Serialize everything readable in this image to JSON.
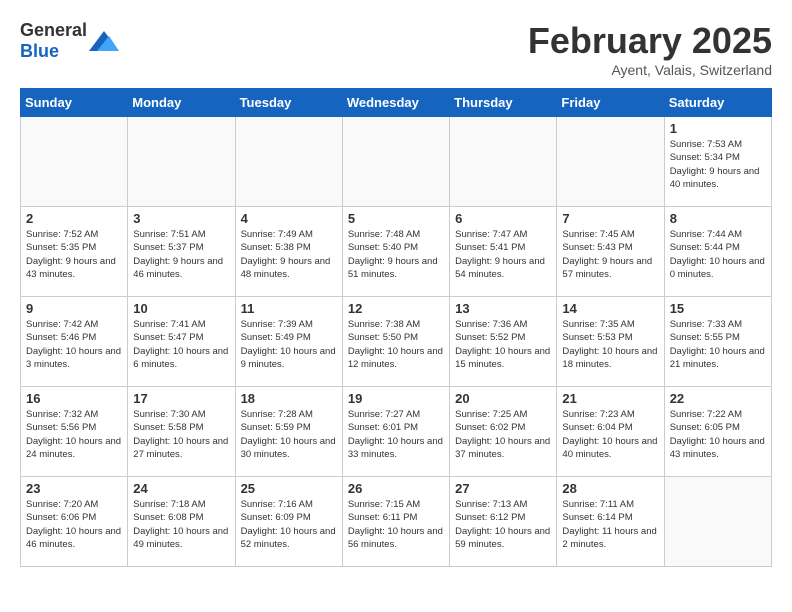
{
  "header": {
    "logo_general": "General",
    "logo_blue": "Blue",
    "month_year": "February 2025",
    "location": "Ayent, Valais, Switzerland"
  },
  "calendar": {
    "days_of_week": [
      "Sunday",
      "Monday",
      "Tuesday",
      "Wednesday",
      "Thursday",
      "Friday",
      "Saturday"
    ],
    "weeks": [
      [
        {
          "day": "",
          "info": ""
        },
        {
          "day": "",
          "info": ""
        },
        {
          "day": "",
          "info": ""
        },
        {
          "day": "",
          "info": ""
        },
        {
          "day": "",
          "info": ""
        },
        {
          "day": "",
          "info": ""
        },
        {
          "day": "1",
          "info": "Sunrise: 7:53 AM\nSunset: 5:34 PM\nDaylight: 9 hours and 40 minutes."
        }
      ],
      [
        {
          "day": "2",
          "info": "Sunrise: 7:52 AM\nSunset: 5:35 PM\nDaylight: 9 hours and 43 minutes."
        },
        {
          "day": "3",
          "info": "Sunrise: 7:51 AM\nSunset: 5:37 PM\nDaylight: 9 hours and 46 minutes."
        },
        {
          "day": "4",
          "info": "Sunrise: 7:49 AM\nSunset: 5:38 PM\nDaylight: 9 hours and 48 minutes."
        },
        {
          "day": "5",
          "info": "Sunrise: 7:48 AM\nSunset: 5:40 PM\nDaylight: 9 hours and 51 minutes."
        },
        {
          "day": "6",
          "info": "Sunrise: 7:47 AM\nSunset: 5:41 PM\nDaylight: 9 hours and 54 minutes."
        },
        {
          "day": "7",
          "info": "Sunrise: 7:45 AM\nSunset: 5:43 PM\nDaylight: 9 hours and 57 minutes."
        },
        {
          "day": "8",
          "info": "Sunrise: 7:44 AM\nSunset: 5:44 PM\nDaylight: 10 hours and 0 minutes."
        }
      ],
      [
        {
          "day": "9",
          "info": "Sunrise: 7:42 AM\nSunset: 5:46 PM\nDaylight: 10 hours and 3 minutes."
        },
        {
          "day": "10",
          "info": "Sunrise: 7:41 AM\nSunset: 5:47 PM\nDaylight: 10 hours and 6 minutes."
        },
        {
          "day": "11",
          "info": "Sunrise: 7:39 AM\nSunset: 5:49 PM\nDaylight: 10 hours and 9 minutes."
        },
        {
          "day": "12",
          "info": "Sunrise: 7:38 AM\nSunset: 5:50 PM\nDaylight: 10 hours and 12 minutes."
        },
        {
          "day": "13",
          "info": "Sunrise: 7:36 AM\nSunset: 5:52 PM\nDaylight: 10 hours and 15 minutes."
        },
        {
          "day": "14",
          "info": "Sunrise: 7:35 AM\nSunset: 5:53 PM\nDaylight: 10 hours and 18 minutes."
        },
        {
          "day": "15",
          "info": "Sunrise: 7:33 AM\nSunset: 5:55 PM\nDaylight: 10 hours and 21 minutes."
        }
      ],
      [
        {
          "day": "16",
          "info": "Sunrise: 7:32 AM\nSunset: 5:56 PM\nDaylight: 10 hours and 24 minutes."
        },
        {
          "day": "17",
          "info": "Sunrise: 7:30 AM\nSunset: 5:58 PM\nDaylight: 10 hours and 27 minutes."
        },
        {
          "day": "18",
          "info": "Sunrise: 7:28 AM\nSunset: 5:59 PM\nDaylight: 10 hours and 30 minutes."
        },
        {
          "day": "19",
          "info": "Sunrise: 7:27 AM\nSunset: 6:01 PM\nDaylight: 10 hours and 33 minutes."
        },
        {
          "day": "20",
          "info": "Sunrise: 7:25 AM\nSunset: 6:02 PM\nDaylight: 10 hours and 37 minutes."
        },
        {
          "day": "21",
          "info": "Sunrise: 7:23 AM\nSunset: 6:04 PM\nDaylight: 10 hours and 40 minutes."
        },
        {
          "day": "22",
          "info": "Sunrise: 7:22 AM\nSunset: 6:05 PM\nDaylight: 10 hours and 43 minutes."
        }
      ],
      [
        {
          "day": "23",
          "info": "Sunrise: 7:20 AM\nSunset: 6:06 PM\nDaylight: 10 hours and 46 minutes."
        },
        {
          "day": "24",
          "info": "Sunrise: 7:18 AM\nSunset: 6:08 PM\nDaylight: 10 hours and 49 minutes."
        },
        {
          "day": "25",
          "info": "Sunrise: 7:16 AM\nSunset: 6:09 PM\nDaylight: 10 hours and 52 minutes."
        },
        {
          "day": "26",
          "info": "Sunrise: 7:15 AM\nSunset: 6:11 PM\nDaylight: 10 hours and 56 minutes."
        },
        {
          "day": "27",
          "info": "Sunrise: 7:13 AM\nSunset: 6:12 PM\nDaylight: 10 hours and 59 minutes."
        },
        {
          "day": "28",
          "info": "Sunrise: 7:11 AM\nSunset: 6:14 PM\nDaylight: 11 hours and 2 minutes."
        },
        {
          "day": "",
          "info": ""
        }
      ]
    ]
  }
}
